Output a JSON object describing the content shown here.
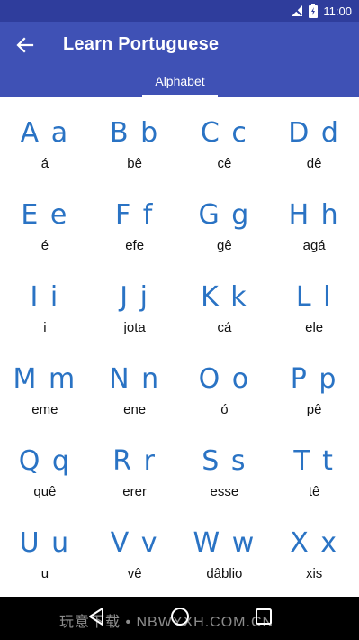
{
  "status_bar": {
    "time": "11:00"
  },
  "app_bar": {
    "title": "Learn Portuguese",
    "tab_label": "Alphabet"
  },
  "alphabet": [
    {
      "letters": "A a",
      "pron": "á"
    },
    {
      "letters": "B b",
      "pron": "bê"
    },
    {
      "letters": "C c",
      "pron": "cê"
    },
    {
      "letters": "D d",
      "pron": "dê"
    },
    {
      "letters": "E e",
      "pron": "é"
    },
    {
      "letters": "F f",
      "pron": "efe"
    },
    {
      "letters": "G g",
      "pron": "gê"
    },
    {
      "letters": "H h",
      "pron": "agá"
    },
    {
      "letters": "I i",
      "pron": "i"
    },
    {
      "letters": "J j",
      "pron": "jota"
    },
    {
      "letters": "K k",
      "pron": "cá"
    },
    {
      "letters": "L l",
      "pron": "ele"
    },
    {
      "letters": "M m",
      "pron": "eme"
    },
    {
      "letters": "N n",
      "pron": "ene"
    },
    {
      "letters": "O o",
      "pron": "ó"
    },
    {
      "letters": "P p",
      "pron": "pê"
    },
    {
      "letters": "Q q",
      "pron": "quê"
    },
    {
      "letters": "R r",
      "pron": "erer"
    },
    {
      "letters": "S s",
      "pron": "esse"
    },
    {
      "letters": "T t",
      "pron": "tê"
    },
    {
      "letters": "U u",
      "pron": "u"
    },
    {
      "letters": "V v",
      "pron": "vê"
    },
    {
      "letters": "W w",
      "pron": "dâblio"
    },
    {
      "letters": "X x",
      "pron": "xis"
    }
  ],
  "watermark": "玩意下载 • NBWYXH.COM.CN",
  "colors": {
    "status_bar": "#2f3d9c",
    "app_bar": "#3f51b5",
    "letter": "#2a73c4"
  },
  "icons": {
    "back": "arrow-left-icon",
    "wifi": "signal-icon",
    "battery": "battery-icon",
    "nav_back": "triangle-back-icon",
    "nav_home": "circle-home-icon",
    "nav_recents": "square-recents-icon"
  }
}
